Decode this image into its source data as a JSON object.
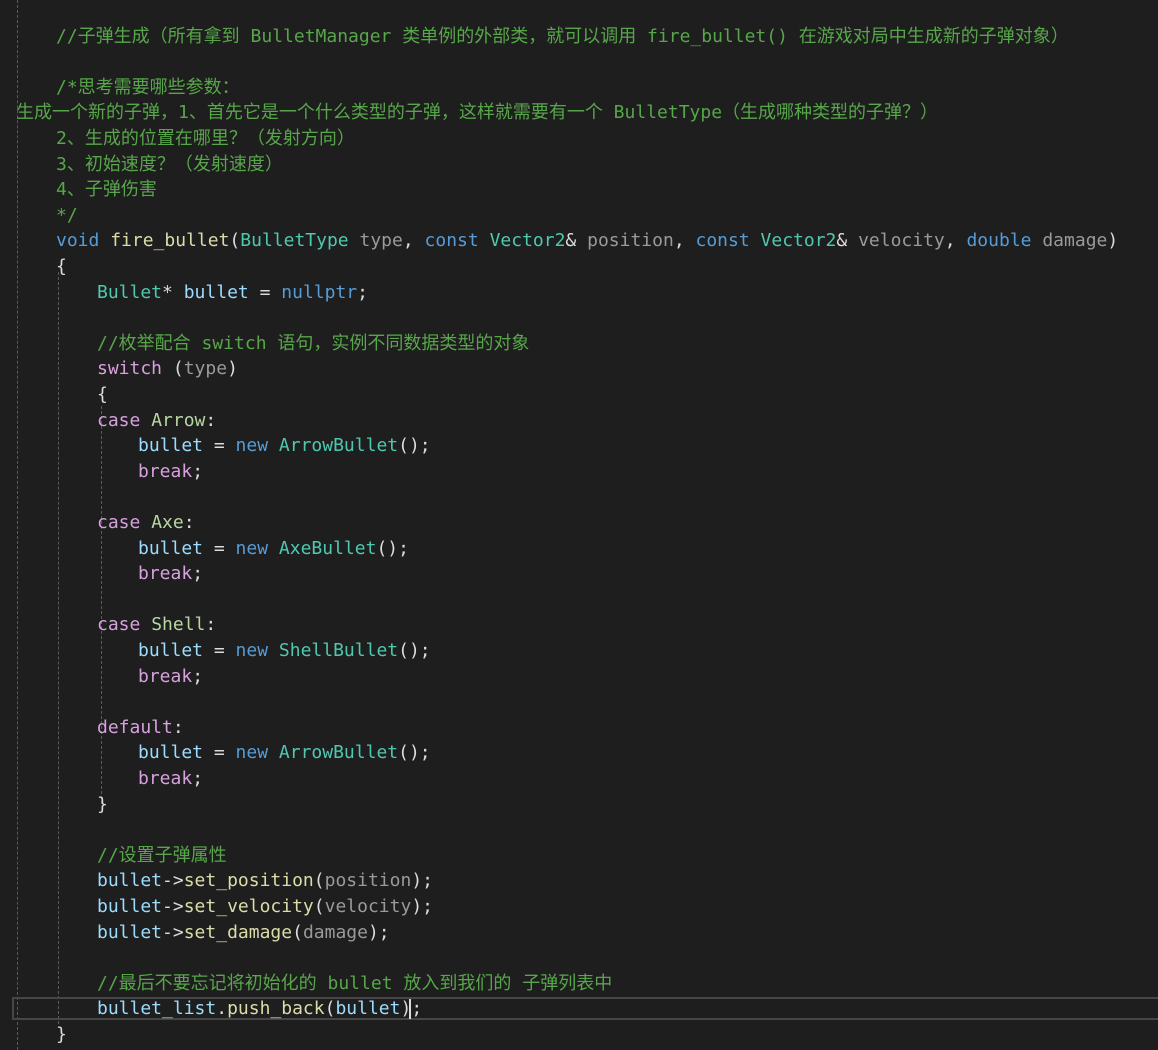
{
  "editor": {
    "lines": [
      {
        "indent": 56,
        "tokens": [
          {
            "t": "//子弹生成（所有拿到 BulletManager 类单例的外部类，就可以调用 fire_bullet() 在游戏对局中生成新的子弹对象）",
            "c": "comment"
          }
        ]
      },
      {
        "indent": 56,
        "tokens": []
      },
      {
        "indent": 56,
        "tokens": [
          {
            "t": "/*思考需要哪些参数：",
            "c": "comment"
          }
        ]
      },
      {
        "indent": 16,
        "tokens": [
          {
            "t": "生成一个新的子弹，1、首先它是一个什么类型的子弹，这样就需要有一个 BulletType（生成哪种类型的子弹？）",
            "c": "comment"
          }
        ]
      },
      {
        "indent": 56,
        "tokens": [
          {
            "t": "2、生成的位置在哪里？（发射方向）",
            "c": "comment"
          }
        ]
      },
      {
        "indent": 56,
        "tokens": [
          {
            "t": "3、初始速度？（发射速度）",
            "c": "comment"
          }
        ]
      },
      {
        "indent": 56,
        "tokens": [
          {
            "t": "4、子弹伤害",
            "c": "comment"
          }
        ]
      },
      {
        "indent": 56,
        "tokens": [
          {
            "t": "*/",
            "c": "comment"
          }
        ]
      },
      {
        "indent": 56,
        "tokens": [
          {
            "t": "void",
            "c": "keyword"
          },
          {
            "t": " ",
            "c": "plain"
          },
          {
            "t": "fire_bullet",
            "c": "func"
          },
          {
            "t": "(",
            "c": "plain"
          },
          {
            "t": "BulletType",
            "c": "type"
          },
          {
            "t": " ",
            "c": "plain"
          },
          {
            "t": "type",
            "c": "param"
          },
          {
            "t": ", ",
            "c": "plain"
          },
          {
            "t": "const",
            "c": "keyword"
          },
          {
            "t": " ",
            "c": "plain"
          },
          {
            "t": "Vector2",
            "c": "type"
          },
          {
            "t": "& ",
            "c": "plain"
          },
          {
            "t": "position",
            "c": "param"
          },
          {
            "t": ", ",
            "c": "plain"
          },
          {
            "t": "const",
            "c": "keyword"
          },
          {
            "t": " ",
            "c": "plain"
          },
          {
            "t": "Vector2",
            "c": "type"
          },
          {
            "t": "& ",
            "c": "plain"
          },
          {
            "t": "velocity",
            "c": "param"
          },
          {
            "t": ", ",
            "c": "plain"
          },
          {
            "t": "double",
            "c": "keyword"
          },
          {
            "t": " ",
            "c": "plain"
          },
          {
            "t": "damage",
            "c": "param"
          },
          {
            "t": ")",
            "c": "plain"
          }
        ]
      },
      {
        "indent": 56,
        "tokens": [
          {
            "t": "{",
            "c": "plain"
          }
        ]
      },
      {
        "indent": 97,
        "tokens": [
          {
            "t": "Bullet",
            "c": "type"
          },
          {
            "t": "* ",
            "c": "plain"
          },
          {
            "t": "bullet",
            "c": "var"
          },
          {
            "t": " = ",
            "c": "plain"
          },
          {
            "t": "nullptr",
            "c": "keyword"
          },
          {
            "t": ";",
            "c": "plain"
          }
        ]
      },
      {
        "indent": 97,
        "tokens": []
      },
      {
        "indent": 97,
        "tokens": [
          {
            "t": "//枚举配合 switch 语句，实例不同数据类型的对象",
            "c": "comment"
          }
        ]
      },
      {
        "indent": 97,
        "tokens": [
          {
            "t": "switch",
            "c": "control"
          },
          {
            "t": " (",
            "c": "plain"
          },
          {
            "t": "type",
            "c": "param"
          },
          {
            "t": ")",
            "c": "plain"
          }
        ]
      },
      {
        "indent": 97,
        "tokens": [
          {
            "t": "{",
            "c": "plain"
          }
        ]
      },
      {
        "indent": 97,
        "tokens": [
          {
            "t": "case",
            "c": "control"
          },
          {
            "t": " ",
            "c": "plain"
          },
          {
            "t": "Arrow",
            "c": "enum"
          },
          {
            "t": ":",
            "c": "plain"
          }
        ]
      },
      {
        "indent": 138,
        "tokens": [
          {
            "t": "bullet",
            "c": "var"
          },
          {
            "t": " = ",
            "c": "plain"
          },
          {
            "t": "new",
            "c": "keyword"
          },
          {
            "t": " ",
            "c": "plain"
          },
          {
            "t": "ArrowBullet",
            "c": "type"
          },
          {
            "t": "();",
            "c": "plain"
          }
        ]
      },
      {
        "indent": 138,
        "tokens": [
          {
            "t": "break",
            "c": "control"
          },
          {
            "t": ";",
            "c": "plain"
          }
        ]
      },
      {
        "indent": 138,
        "tokens": []
      },
      {
        "indent": 97,
        "tokens": [
          {
            "t": "case",
            "c": "control"
          },
          {
            "t": " ",
            "c": "plain"
          },
          {
            "t": "Axe",
            "c": "enum"
          },
          {
            "t": ":",
            "c": "plain"
          }
        ]
      },
      {
        "indent": 138,
        "tokens": [
          {
            "t": "bullet",
            "c": "var"
          },
          {
            "t": " = ",
            "c": "plain"
          },
          {
            "t": "new",
            "c": "keyword"
          },
          {
            "t": " ",
            "c": "plain"
          },
          {
            "t": "AxeBullet",
            "c": "type"
          },
          {
            "t": "();",
            "c": "plain"
          }
        ]
      },
      {
        "indent": 138,
        "tokens": [
          {
            "t": "break",
            "c": "control"
          },
          {
            "t": ";",
            "c": "plain"
          }
        ]
      },
      {
        "indent": 138,
        "tokens": []
      },
      {
        "indent": 97,
        "tokens": [
          {
            "t": "case",
            "c": "control"
          },
          {
            "t": " ",
            "c": "plain"
          },
          {
            "t": "Shell",
            "c": "enum"
          },
          {
            "t": ":",
            "c": "plain"
          }
        ]
      },
      {
        "indent": 138,
        "tokens": [
          {
            "t": "bullet",
            "c": "var"
          },
          {
            "t": " = ",
            "c": "plain"
          },
          {
            "t": "new",
            "c": "keyword"
          },
          {
            "t": " ",
            "c": "plain"
          },
          {
            "t": "ShellBullet",
            "c": "type"
          },
          {
            "t": "();",
            "c": "plain"
          }
        ]
      },
      {
        "indent": 138,
        "tokens": [
          {
            "t": "break",
            "c": "control"
          },
          {
            "t": ";",
            "c": "plain"
          }
        ]
      },
      {
        "indent": 138,
        "tokens": []
      },
      {
        "indent": 97,
        "tokens": [
          {
            "t": "default",
            "c": "control"
          },
          {
            "t": ":",
            "c": "plain"
          }
        ]
      },
      {
        "indent": 138,
        "tokens": [
          {
            "t": "bullet",
            "c": "var"
          },
          {
            "t": " = ",
            "c": "plain"
          },
          {
            "t": "new",
            "c": "keyword"
          },
          {
            "t": " ",
            "c": "plain"
          },
          {
            "t": "ArrowBullet",
            "c": "type"
          },
          {
            "t": "();",
            "c": "plain"
          }
        ]
      },
      {
        "indent": 138,
        "tokens": [
          {
            "t": "break",
            "c": "control"
          },
          {
            "t": ";",
            "c": "plain"
          }
        ]
      },
      {
        "indent": 97,
        "tokens": [
          {
            "t": "}",
            "c": "plain"
          }
        ]
      },
      {
        "indent": 97,
        "tokens": []
      },
      {
        "indent": 97,
        "tokens": [
          {
            "t": "//设置子弹属性",
            "c": "comment"
          }
        ]
      },
      {
        "indent": 97,
        "tokens": [
          {
            "t": "bullet",
            "c": "var"
          },
          {
            "t": "->",
            "c": "plain"
          },
          {
            "t": "set_position",
            "c": "func"
          },
          {
            "t": "(",
            "c": "plain"
          },
          {
            "t": "position",
            "c": "param"
          },
          {
            "t": ");",
            "c": "plain"
          }
        ]
      },
      {
        "indent": 97,
        "tokens": [
          {
            "t": "bullet",
            "c": "var"
          },
          {
            "t": "->",
            "c": "plain"
          },
          {
            "t": "set_velocity",
            "c": "func"
          },
          {
            "t": "(",
            "c": "plain"
          },
          {
            "t": "velocity",
            "c": "param"
          },
          {
            "t": ");",
            "c": "plain"
          }
        ]
      },
      {
        "indent": 97,
        "tokens": [
          {
            "t": "bullet",
            "c": "var"
          },
          {
            "t": "->",
            "c": "plain"
          },
          {
            "t": "set_damage",
            "c": "func"
          },
          {
            "t": "(",
            "c": "plain"
          },
          {
            "t": "damage",
            "c": "param"
          },
          {
            "t": ");",
            "c": "plain"
          }
        ]
      },
      {
        "indent": 97,
        "tokens": []
      },
      {
        "indent": 97,
        "tokens": [
          {
            "t": "//最后不要忘记将初始化的 bullet 放入到我们的 子弹列表中",
            "c": "comment"
          }
        ]
      },
      {
        "indent": 97,
        "tokens": [
          {
            "t": "bullet_list",
            "c": "var"
          },
          {
            "t": ".",
            "c": "plain"
          },
          {
            "t": "push_back",
            "c": "func"
          },
          {
            "t": "(",
            "c": "plain"
          },
          {
            "t": "bullet",
            "c": "var"
          },
          {
            "t": ");",
            "c": "plain"
          }
        ]
      },
      {
        "indent": 56,
        "tokens": [
          {
            "t": "}",
            "c": "plain"
          }
        ]
      }
    ]
  }
}
